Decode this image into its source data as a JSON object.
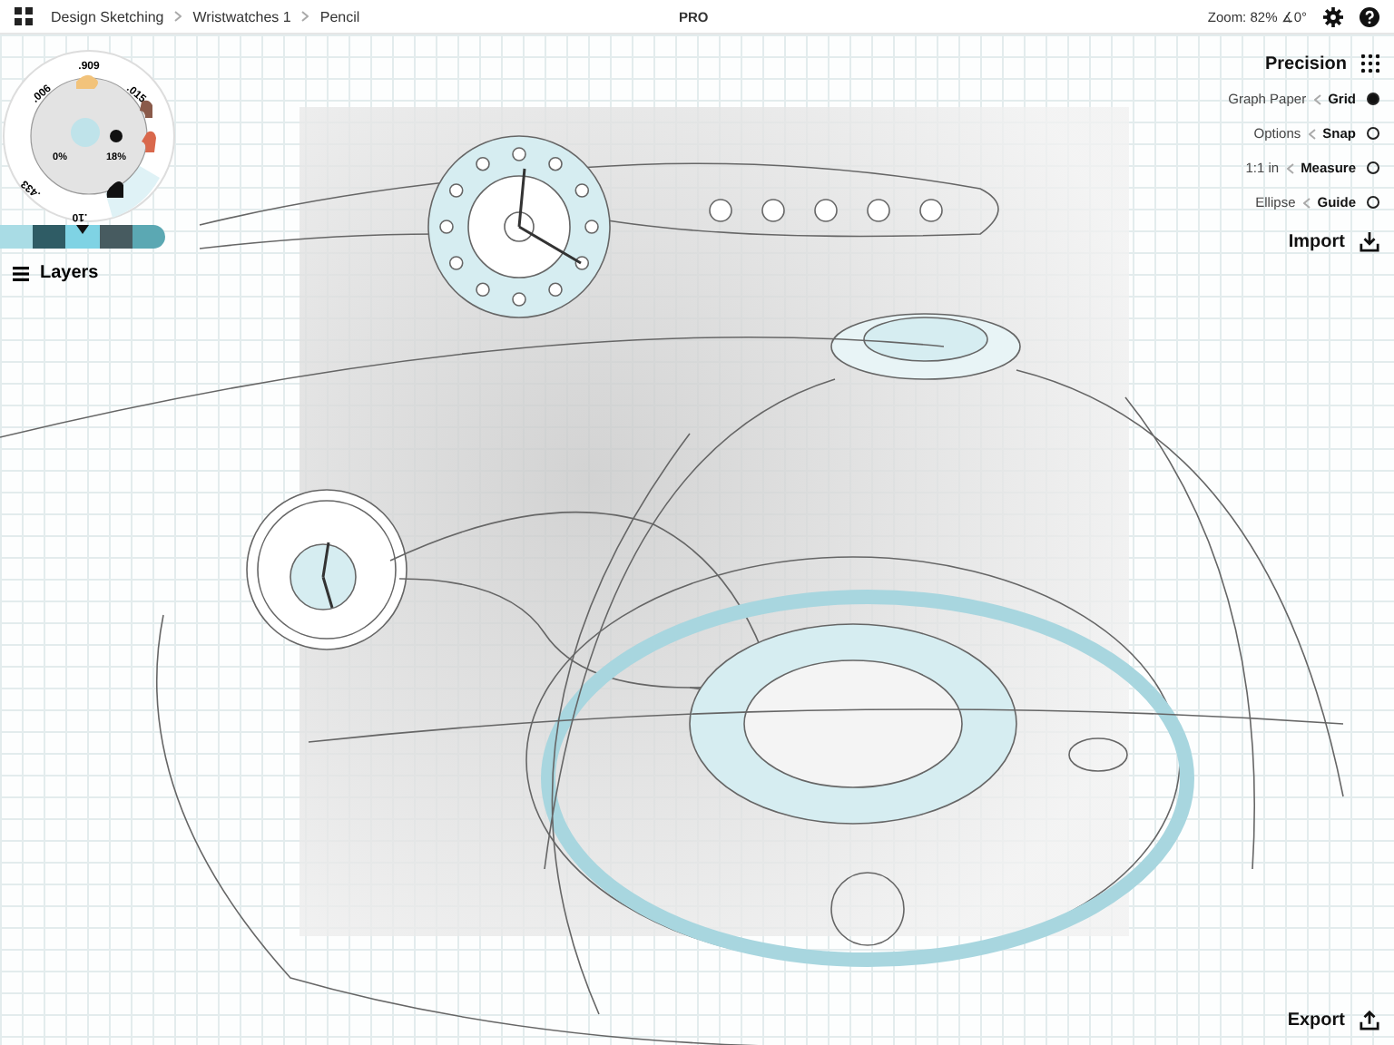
{
  "top_bar": {
    "breadcrumbs": [
      "Design Sketching",
      "Wristwatches 1",
      "Pencil"
    ],
    "badge": "PRO",
    "zoom": "Zoom: 82% ∡0°"
  },
  "tool_wheel": {
    "brush_sizes": [
      ".006",
      ".909",
      ".015",
      ".433",
      ".10"
    ],
    "opacity": "0%",
    "smoothing": "18%"
  },
  "palette": [
    {
      "color": "#a9dce5",
      "selected": false
    },
    {
      "color": "#2f5c65",
      "selected": false
    },
    {
      "color": "#7fd3e4",
      "selected": true
    },
    {
      "color": "#475b60",
      "selected": false
    },
    {
      "color": "#5ba8b3",
      "selected": false
    }
  ],
  "layers": {
    "label": "Layers"
  },
  "precision": {
    "title": "Precision",
    "items": [
      {
        "label": "Graph Paper",
        "name": "Grid",
        "on": true
      },
      {
        "label": "Options",
        "name": "Snap",
        "on": false
      },
      {
        "label": "1:1 in",
        "name": "Measure",
        "on": false
      },
      {
        "label": "Ellipse",
        "name": "Guide",
        "on": false
      }
    ]
  },
  "import": "Import",
  "export": "Export"
}
